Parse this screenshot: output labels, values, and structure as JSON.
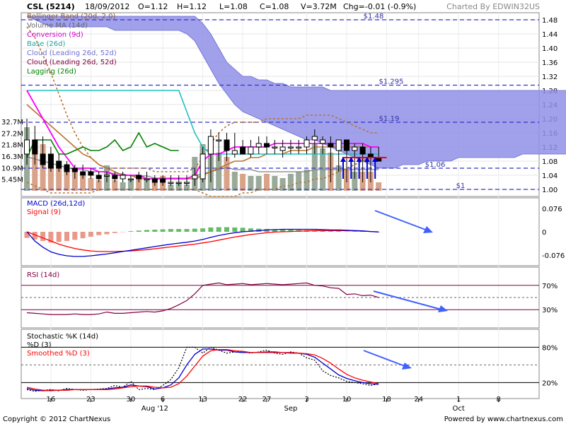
{
  "header": {
    "symbol": "CSL (5214)",
    "date": "18/09/2012",
    "open": "O=1.12",
    "high": "H=1.12",
    "low": "L=1.08",
    "close": "C=1.08",
    "volume": "V=3.72M",
    "change": "Chg=-0.01 (-0.9%)",
    "charted_by": "Charted By EDWIN32US"
  },
  "footer": {
    "copyright": "Copyright © 2012 ChartNexus",
    "powered_by": "Powered by www.chartnexus.com"
  },
  "colors": {
    "cloud": "#8f8fe8",
    "bollinger": "#b87333",
    "volume_ma": "#808080",
    "conversion": "#ff00ff",
    "base": "#20c0c0",
    "lagging": "#008000",
    "macd": "#0000cc",
    "signal": "#ff0000",
    "rsi": "#800040",
    "hist_up": "#66bb66",
    "hist_down": "#e89a8a",
    "vol_up": "#99aa99",
    "vol_down": "#d9a38a",
    "ref_line": "#3333cc",
    "trend_arrow": "#4060ff"
  },
  "chart_data": [
    {
      "type": "candlestick",
      "panel": "price",
      "legend": [
        "Bollinger Band (20d, 2.0)",
        "Volume MA (14d)",
        "Conversion (9d)",
        "Base (26d)",
        "Cloud (Leading 26d, 52d)",
        "Cloud (Leading 26d, 52d)",
        "Lagging (26d)"
      ],
      "yticks": [
        1.0,
        1.04,
        1.08,
        1.12,
        1.16,
        1.2,
        1.24,
        1.28,
        1.32,
        1.36,
        1.4,
        1.44,
        1.48
      ],
      "ylim": [
        0.98,
        1.5
      ],
      "volume_ticks": [
        "5.45M",
        "10.9M",
        "16.3M",
        "21.8M",
        "27.2M",
        "32.7M"
      ],
      "volume_tick_values": [
        5.45,
        10.9,
        16.3,
        21.8,
        27.2,
        32.7
      ],
      "volume_ylim": [
        0,
        40
      ],
      "reference_lines": [
        {
          "label": "$1.48",
          "value": 1.48
        },
        {
          "label": "$1.295",
          "value": 1.295
        },
        {
          "label": "$1.19",
          "value": 1.19
        },
        {
          "label": "$1.06",
          "value": 1.06
        },
        {
          "label": "$1",
          "value": 1.0
        }
      ],
      "x_labels": [
        "16",
        "23",
        "30",
        "6",
        "13",
        "22",
        "27",
        "3",
        "10",
        "18",
        "24",
        "1",
        "8"
      ],
      "x_label_index": [
        3,
        8,
        13,
        17,
        22,
        27,
        30,
        35,
        40,
        45,
        49,
        54,
        59
      ],
      "month_labels": [
        {
          "text": "Aug '12",
          "index": 16
        },
        {
          "text": "Sep",
          "index": 33
        },
        {
          "text": "Oct",
          "index": 54
        }
      ],
      "candles": {
        "open": [
          1.1,
          1.14,
          1.1,
          1.1,
          1.08,
          1.07,
          1.06,
          1.05,
          1.05,
          1.04,
          1.04,
          1.04,
          1.03,
          1.03,
          1.04,
          1.03,
          1.03,
          1.03,
          1.02,
          1.02,
          1.02,
          1.03,
          1.03,
          1.1,
          1.14,
          1.14,
          1.1,
          1.12,
          1.1,
          1.12,
          1.13,
          1.12,
          1.11,
          1.12,
          1.12,
          1.12,
          1.14,
          1.13,
          1.13,
          1.11,
          1.14,
          1.11,
          1.12,
          1.1,
          1.09
        ],
        "high": [
          1.2,
          1.18,
          1.15,
          1.12,
          1.1,
          1.08,
          1.07,
          1.07,
          1.06,
          1.05,
          1.05,
          1.05,
          1.05,
          1.04,
          1.05,
          1.05,
          1.04,
          1.04,
          1.04,
          1.04,
          1.04,
          1.06,
          1.12,
          1.17,
          1.16,
          1.16,
          1.16,
          1.14,
          1.14,
          1.15,
          1.15,
          1.14,
          1.14,
          1.14,
          1.14,
          1.15,
          1.17,
          1.15,
          1.15,
          1.14,
          1.14,
          1.13,
          1.13,
          1.12,
          1.12
        ],
        "low": [
          1.07,
          1.07,
          1.06,
          1.05,
          1.05,
          1.04,
          1.03,
          1.03,
          1.03,
          1.02,
          1.02,
          1.02,
          1.02,
          1.02,
          1.02,
          1.02,
          1.01,
          1.01,
          1.01,
          1.01,
          1.01,
          1.01,
          1.02,
          1.02,
          1.08,
          1.08,
          1.09,
          1.1,
          1.09,
          1.1,
          1.1,
          1.1,
          1.09,
          1.1,
          1.1,
          1.1,
          1.1,
          1.1,
          1.02,
          1.05,
          1.02,
          1.03,
          1.02,
          1.02,
          1.08
        ],
        "close": [
          1.14,
          1.1,
          1.07,
          1.06,
          1.06,
          1.05,
          1.05,
          1.04,
          1.04,
          1.03,
          1.04,
          1.03,
          1.04,
          1.03,
          1.03,
          1.03,
          1.02,
          1.02,
          1.02,
          1.02,
          1.02,
          1.04,
          1.1,
          1.15,
          1.14,
          1.11,
          1.11,
          1.1,
          1.12,
          1.13,
          1.12,
          1.12,
          1.12,
          1.12,
          1.12,
          1.14,
          1.15,
          1.14,
          1.12,
          1.14,
          1.11,
          1.12,
          1.1,
          1.09,
          1.08
        ]
      },
      "volume": [
        30,
        24,
        22,
        14,
        11,
        9,
        10,
        7,
        6,
        5,
        12,
        5,
        4,
        5,
        7,
        5,
        4,
        7,
        3,
        4,
        3,
        16,
        22,
        24,
        18,
        16,
        9,
        8,
        7,
        7,
        8,
        7,
        6,
        8,
        9,
        10,
        22,
        20,
        18,
        12,
        10,
        9,
        9,
        9,
        4
      ],
      "volume_ma": [
        16,
        15,
        14,
        13,
        12,
        11,
        10,
        10,
        9,
        9,
        9,
        8,
        8,
        7,
        7,
        7,
        6,
        6,
        6,
        6,
        6,
        7,
        8,
        9,
        10,
        11,
        10,
        10,
        10,
        9,
        9,
        9,
        9,
        9,
        9,
        9,
        10,
        10,
        10,
        10,
        10,
        10,
        10,
        10,
        10
      ],
      "bollinger_upper": [
        1.46,
        1.43,
        1.38,
        1.33,
        1.27,
        1.21,
        1.16,
        1.12,
        1.09,
        1.07,
        1.06,
        1.06,
        1.06,
        1.06,
        1.06,
        1.06,
        1.05,
        1.05,
        1.05,
        1.05,
        1.05,
        1.06,
        1.09,
        1.13,
        1.16,
        1.18,
        1.19,
        1.19,
        1.19,
        1.19,
        1.2,
        1.2,
        1.2,
        1.2,
        1.2,
        1.21,
        1.21,
        1.21,
        1.21,
        1.2,
        1.19,
        1.18,
        1.17,
        1.16,
        1.16
      ],
      "bollinger_mid": [
        1.24,
        1.22,
        1.2,
        1.18,
        1.16,
        1.14,
        1.12,
        1.1,
        1.09,
        1.07,
        1.06,
        1.05,
        1.04,
        1.04,
        1.03,
        1.03,
        1.03,
        1.03,
        1.03,
        1.03,
        1.03,
        1.03,
        1.04,
        1.05,
        1.06,
        1.07,
        1.08,
        1.08,
        1.09,
        1.09,
        1.1,
        1.1,
        1.1,
        1.11,
        1.11,
        1.11,
        1.12,
        1.12,
        1.12,
        1.12,
        1.12,
        1.12,
        1.12,
        1.12,
        1.12
      ],
      "bollinger_lower": [
        1.02,
        1.01,
        1.0,
        0.99,
        0.99,
        0.99,
        0.99,
        0.99,
        0.99,
        1.0,
        1.0,
        1.0,
        1.0,
        1.0,
        1.0,
        1.0,
        1.0,
        1.0,
        1.0,
        1.0,
        1.0,
        1.0,
        0.99,
        0.98,
        0.98,
        0.98,
        0.98,
        0.99,
        0.99,
        1.0,
        1.0,
        1.0,
        1.01,
        1.01,
        1.02,
        1.02,
        1.03,
        1.03,
        1.04,
        1.05,
        1.06,
        1.07,
        1.08,
        1.09,
        1.09
      ],
      "conversion": [
        1.28,
        1.24,
        1.2,
        1.16,
        1.12,
        1.09,
        1.06,
        1.06,
        1.06,
        1.05,
        1.05,
        1.04,
        1.04,
        1.04,
        1.04,
        1.03,
        1.03,
        1.03,
        1.03,
        1.03,
        1.03,
        1.04,
        1.08,
        1.1,
        1.1,
        1.11,
        1.12,
        1.12,
        1.12,
        1.12,
        1.12,
        1.13,
        1.13,
        1.13,
        1.13,
        1.13,
        1.13,
        1.13,
        1.13,
        1.13,
        1.13,
        1.13,
        1.13,
        1.12,
        1.12
      ],
      "base": [
        1.28,
        1.28,
        1.28,
        1.28,
        1.28,
        1.28,
        1.28,
        1.28,
        1.28,
        1.28,
        1.28,
        1.28,
        1.28,
        1.28,
        1.28,
        1.28,
        1.28,
        1.28,
        1.28,
        1.28,
        1.22,
        1.16,
        1.12,
        1.1,
        1.1,
        1.1,
        1.1,
        1.1,
        1.1,
        1.1,
        1.1,
        1.1,
        1.1,
        1.1,
        1.1,
        1.1,
        1.1,
        1.1,
        1.1,
        1.1,
        1.1,
        1.1,
        1.1,
        1.1,
        1.1
      ],
      "lagging": [
        1.09,
        1.14,
        1.14,
        1.14,
        1.1,
        1.1,
        1.11,
        1.12,
        1.11,
        1.11,
        1.12,
        1.14,
        1.11,
        1.12,
        1.16,
        1.12,
        1.13,
        1.12,
        1.11,
        1.11
      ],
      "cloud_top": [
        1.49,
        1.49,
        1.49,
        1.49,
        1.49,
        1.49,
        1.49,
        1.49,
        1.49,
        1.49,
        1.49,
        1.49,
        1.49,
        1.49,
        1.49,
        1.49,
        1.49,
        1.49,
        1.49,
        1.49,
        1.49,
        1.49,
        1.47,
        1.44,
        1.4,
        1.36,
        1.34,
        1.32,
        1.32,
        1.31,
        1.31,
        1.3,
        1.3,
        1.29,
        1.29,
        1.29,
        1.29,
        1.29,
        1.28,
        1.28,
        1.28,
        1.28,
        1.28,
        1.28,
        1.28,
        1.28,
        1.28,
        1.28,
        1.28,
        1.28,
        1.28,
        1.28,
        1.28,
        1.28,
        1.28,
        1.28,
        1.28,
        1.28,
        1.28,
        1.28,
        1.28,
        1.28,
        1.28,
        1.28,
        1.28,
        1.28,
        1.28,
        1.28,
        1.28,
        1.28,
        1.28
      ],
      "cloud_bottom": [
        1.49,
        1.48,
        1.47,
        1.46,
        1.46,
        1.46,
        1.46,
        1.46,
        1.46,
        1.46,
        1.46,
        1.45,
        1.45,
        1.45,
        1.45,
        1.45,
        1.45,
        1.45,
        1.45,
        1.45,
        1.44,
        1.42,
        1.38,
        1.34,
        1.3,
        1.27,
        1.24,
        1.22,
        1.21,
        1.2,
        1.19,
        1.18,
        1.17,
        1.16,
        1.15,
        1.14,
        1.14,
        1.13,
        1.12,
        1.11,
        1.1,
        1.09,
        1.08,
        1.07,
        1.06,
        1.06,
        1.06,
        1.07,
        1.07,
        1.07,
        1.08,
        1.08,
        1.08,
        1.08,
        1.09,
        1.09,
        1.09,
        1.09,
        1.09,
        1.09,
        1.09,
        1.09,
        1.1,
        1.1,
        1.1,
        1.1,
        1.1,
        1.1,
        1.1,
        1.11,
        1.11
      ]
    },
    {
      "type": "line",
      "panel": "macd",
      "legend": [
        "MACD (26d,12d)",
        "Signal (9)"
      ],
      "yticks": [
        "0.076",
        "0",
        "-0.076"
      ],
      "ytick_values": [
        0.076,
        0,
        -0.076
      ],
      "ylim": [
        -0.11,
        0.11
      ],
      "series": [
        {
          "name": "MACD (26d,12d)",
          "values": [
            0,
            -0.03,
            -0.05,
            -0.065,
            -0.073,
            -0.078,
            -0.08,
            -0.08,
            -0.078,
            -0.075,
            -0.072,
            -0.068,
            -0.064,
            -0.06,
            -0.056,
            -0.052,
            -0.048,
            -0.044,
            -0.04,
            -0.037,
            -0.034,
            -0.03,
            -0.025,
            -0.018,
            -0.012,
            -0.007,
            -0.003,
            0.0,
            0.002,
            0.004,
            0.006,
            0.007,
            0.008,
            0.008,
            0.008,
            0.008,
            0.008,
            0.007,
            0.006,
            0.006,
            0.005,
            0.004,
            0.003,
            0.001,
            -0.001
          ]
        },
        {
          "name": "Signal (9)",
          "values": [
            0,
            -0.01,
            -0.02,
            -0.03,
            -0.04,
            -0.048,
            -0.054,
            -0.059,
            -0.062,
            -0.064,
            -0.064,
            -0.064,
            -0.063,
            -0.062,
            -0.06,
            -0.058,
            -0.055,
            -0.052,
            -0.049,
            -0.046,
            -0.043,
            -0.04,
            -0.036,
            -0.032,
            -0.027,
            -0.022,
            -0.017,
            -0.013,
            -0.009,
            -0.006,
            -0.003,
            -0.001,
            0.0,
            0.001,
            0.002,
            0.003,
            0.004,
            0.004,
            0.004,
            0.004,
            0.004,
            0.003,
            0.002,
            0.001,
            0.0
          ]
        }
      ],
      "histogram": [
        -0.02,
        -0.025,
        -0.03,
        -0.035,
        -0.033,
        -0.03,
        -0.026,
        -0.021,
        -0.016,
        -0.011,
        -0.008,
        -0.004,
        -0.001,
        0.002,
        0.004,
        0.006,
        0.007,
        0.008,
        0.009,
        0.009,
        0.009,
        0.01,
        0.011,
        0.014,
        0.015,
        0.015,
        0.014,
        0.013,
        0.011,
        0.01,
        0.009,
        0.008,
        0.008,
        0.007,
        0.006,
        0.005,
        0.004,
        0.003,
        0.002,
        0.002,
        0.001,
        0.001,
        0.001,
        0.0,
        -0.001
      ]
    },
    {
      "type": "line",
      "panel": "rsi",
      "legend": [
        "RSI (14d)"
      ],
      "yticks": [
        "70%",
        "30%"
      ],
      "ytick_values": [
        70,
        30
      ],
      "ylim": [
        0,
        100
      ],
      "series": [
        {
          "name": "RSI (14d)",
          "values": [
            25,
            24,
            23,
            22,
            22,
            22,
            23,
            22,
            22,
            23,
            26,
            24,
            24,
            25,
            26,
            27,
            26,
            28,
            32,
            38,
            45,
            56,
            70,
            72,
            74,
            71,
            72,
            73,
            71,
            72,
            73,
            72,
            71,
            72,
            73,
            74,
            70,
            69,
            66,
            65,
            55,
            56,
            53,
            54,
            50
          ]
        }
      ]
    },
    {
      "type": "line",
      "panel": "stochastic",
      "legend": [
        "Stochastic %K (14d)",
        "%D (3)",
        "Smoothed %D (3)"
      ],
      "yticks": [
        "80%",
        "20%"
      ],
      "ytick_values": [
        80,
        20
      ],
      "ylim": [
        0,
        100
      ],
      "series": [
        {
          "name": "Stochastic %K (14d)",
          "values": [
            8,
            5,
            7,
            8,
            6,
            10,
            8,
            7,
            8,
            9,
            10,
            15,
            12,
            22,
            8,
            10,
            8,
            15,
            25,
            45,
            80,
            80,
            70,
            80,
            75,
            70,
            72,
            72,
            70,
            72,
            75,
            70,
            68,
            72,
            70,
            62,
            58,
            40,
            32,
            28,
            22,
            20,
            18,
            15,
            18
          ]
        },
        {
          "name": "%D (3)",
          "values": [
            10,
            7,
            6,
            7,
            7,
            8,
            8,
            8,
            8,
            8,
            9,
            11,
            12,
            16,
            14,
            13,
            9,
            11,
            16,
            28,
            50,
            68,
            77,
            77,
            75,
            75,
            72,
            71,
            71,
            71,
            72,
            72,
            71,
            70,
            70,
            68,
            63,
            53,
            43,
            33,
            27,
            23,
            20,
            18,
            17
          ]
        },
        {
          "name": "Smoothed %D (3)",
          "values": [
            12,
            9,
            7,
            6,
            7,
            7,
            8,
            8,
            8,
            8,
            8,
            9,
            11,
            13,
            14,
            14,
            12,
            11,
            12,
            18,
            31,
            48,
            65,
            74,
            76,
            76,
            74,
            73,
            71,
            71,
            71,
            71,
            71,
            71,
            70,
            69,
            67,
            61,
            53,
            43,
            34,
            28,
            24,
            21,
            18
          ]
        }
      ]
    }
  ]
}
